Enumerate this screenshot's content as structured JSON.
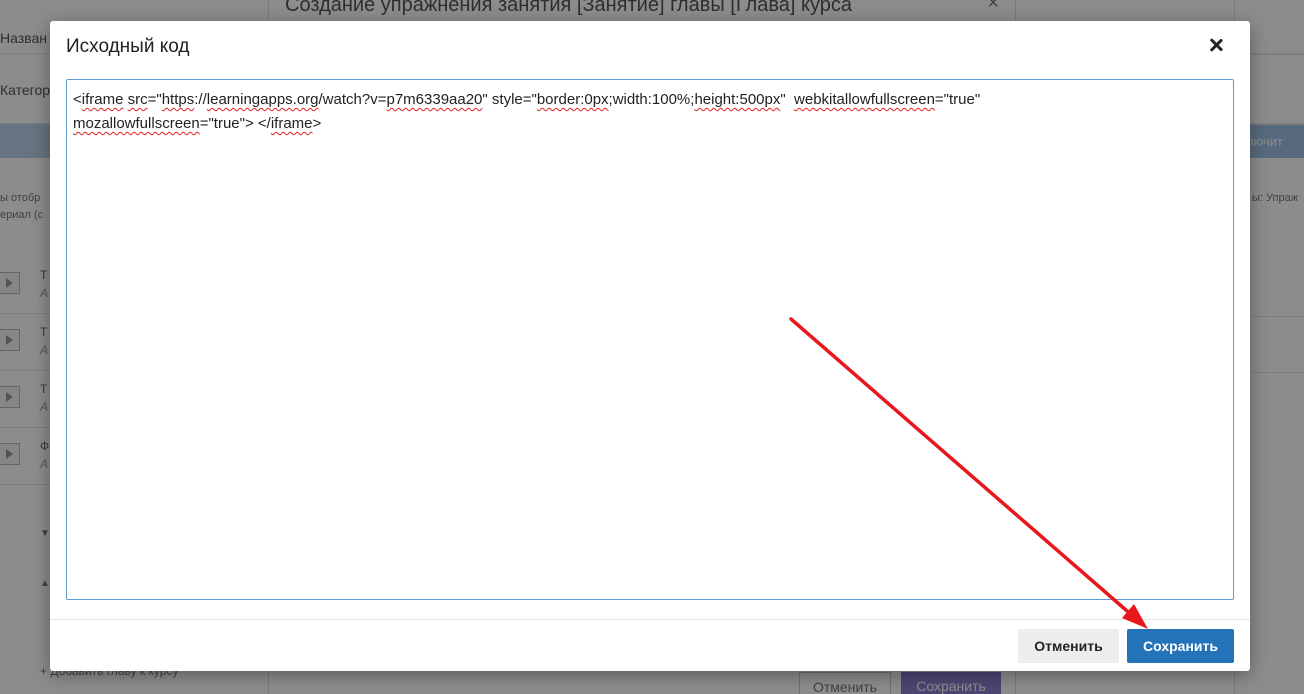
{
  "background": {
    "page_labels": [
      "Назван",
      "Категор"
    ],
    "modal_title": "Создание упражнения занятия [Занятие] главы [Глава] курса",
    "right_button_label": "ключит",
    "note_left_1": "ы отобр",
    "note_left_2": "ериал (с",
    "note_right": "ы: Упраж",
    "items": [
      {
        "t": "Т",
        "a": "А"
      },
      {
        "t": "Т",
        "a": "А"
      },
      {
        "t": "Т",
        "a": "А"
      },
      {
        "t": "Ф",
        "a": "А"
      }
    ],
    "add_chapter_label": "Добавить главу к курсу",
    "cancel_label": "Отменить",
    "save_label": "Сохранить"
  },
  "dialog": {
    "title": "Исходный код",
    "code": {
      "line1_parts": [
        "<",
        "iframe",
        " ",
        "src",
        "=\"",
        "https",
        "://",
        "learningapps.org",
        "/watch?v=",
        "p7m6339aa20",
        "\" style=\"",
        "border:0px",
        ";width:100%;",
        "height:500px",
        "\"  ",
        "webkitallowfullscreen",
        "=\"true\""
      ],
      "line2_parts": [
        "mozallowfullscreen",
        "=\"true\"> </",
        "iframe",
        ">"
      ]
    },
    "buttons": {
      "cancel": "Отменить",
      "save": "Сохранить"
    }
  },
  "colors": {
    "primary": "#2472b8",
    "annotation_arrow": "#e8171b"
  }
}
